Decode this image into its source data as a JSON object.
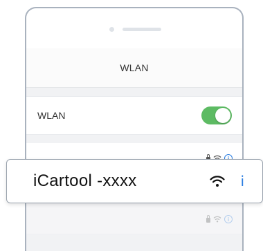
{
  "screen": {
    "nav_title": "WLAN",
    "wlan_toggle": {
      "label": "WLAN",
      "state": "on",
      "color": "#5dbb63"
    },
    "hidden_networks": [
      {
        "secured": true,
        "icons": [
          "lock-icon",
          "wifi-icon",
          "info-icon"
        ]
      },
      {
        "secured": true,
        "icons": [
          "lock-icon",
          "wifi-icon",
          "info-icon"
        ]
      },
      {
        "secured": true,
        "icons": [
          "lock-icon",
          "wifi-icon",
          "info-icon"
        ]
      }
    ]
  },
  "callout": {
    "network_name": "iCartool -xxxx",
    "info_glyph": "i",
    "icons": [
      "wifi-icon",
      "info-icon"
    ],
    "accent_color": "#2a7de1"
  }
}
